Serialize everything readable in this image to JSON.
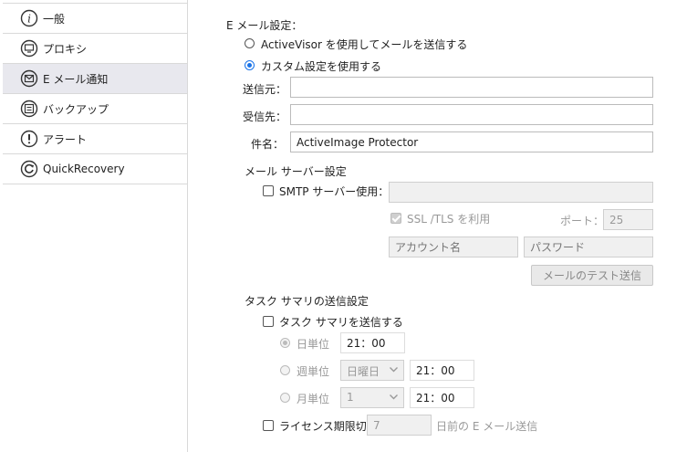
{
  "sidebar": {
    "items": [
      {
        "label": "一般",
        "icon": "info-icon"
      },
      {
        "label": "プロキシ",
        "icon": "monitor-icon"
      },
      {
        "label": "E メール通知",
        "icon": "mail-icon"
      },
      {
        "label": "バックアップ",
        "icon": "list-icon"
      },
      {
        "label": "アラート",
        "icon": "alert-icon"
      },
      {
        "label": "QuickRecovery",
        "icon": "recovery-icon"
      }
    ],
    "active_index": 2
  },
  "email_settings": {
    "section_title": "E メール設定：",
    "option_activevisor": "ActiveVisor を使用してメールを送信する",
    "option_custom": "カスタム設定を使用する",
    "selected": "custom",
    "from_label": "送信元：",
    "from_value": "",
    "to_label": "受信先：",
    "to_value": "",
    "subject_label": "件名：",
    "subject_value": "ActiveImage Protector"
  },
  "mail_server": {
    "section_title": "メール サーバー設定",
    "smtp_label": "SMTP サーバー使用：",
    "smtp_checked": false,
    "smtp_value": "",
    "ssl_label": "SSL /TLS を利用",
    "ssl_checked": true,
    "port_label": "ポート：",
    "port_value": "25",
    "account_placeholder": "アカウント名",
    "password_placeholder": "パスワード",
    "test_button": "メールのテスト送信"
  },
  "task_summary": {
    "section_title": "タスク サマリの送信設定",
    "send_label": "タスク サマリを送信する",
    "send_checked": false,
    "daily_label": "日単位",
    "daily_time": "21：00",
    "weekly_label": "週単位",
    "weekly_day": "日曜日",
    "weekly_time": "21：00",
    "monthly_label": "月単位",
    "monthly_day": "1",
    "monthly_time": "21：00",
    "selected": "daily"
  },
  "license": {
    "label": "ライセンス期限切れ",
    "days_value": "7",
    "suffix": "日前の E メール送信",
    "checked": false
  },
  "colors": {
    "accent": "#1a73e8",
    "active_nav": "#e8e8ee",
    "border": "#d9d9d9"
  }
}
